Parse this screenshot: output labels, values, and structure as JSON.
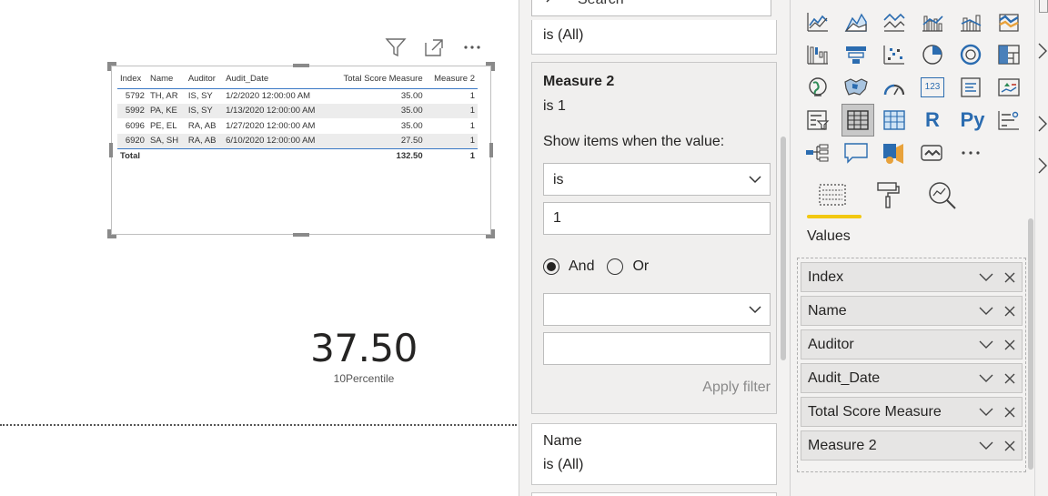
{
  "table": {
    "headers": [
      "Index",
      "Name",
      "Auditor",
      "Audit_Date",
      "Total Score Measure",
      "Measure 2"
    ],
    "rows": [
      [
        "5792",
        "TH, AR",
        "IS, SY",
        "1/2/2020 12:00:00 AM",
        "35.00",
        "1"
      ],
      [
        "5992",
        "PA, KE",
        "IS, SY",
        "1/13/2020 12:00:00 AM",
        "35.00",
        "1"
      ],
      [
        "6096",
        "PE, EL",
        "RA, AB",
        "1/27/2020 12:00:00 AM",
        "35.00",
        "1"
      ],
      [
        "6920",
        "SA, SH",
        "RA, AB",
        "6/10/2020 12:00:00 AM",
        "27.50",
        "1"
      ]
    ],
    "total": {
      "label": "Total",
      "score": "132.50",
      "measure2": "1"
    }
  },
  "card": {
    "value": "37.50",
    "label": "10Percentile"
  },
  "filters": {
    "search_label": "Search",
    "top_card_value": "is (All)",
    "measure_card": {
      "title": "Measure 2",
      "subtitle": "is 1",
      "show_items": "Show items when the value:",
      "condition1": "is",
      "value1": "1",
      "and_label": "And",
      "or_label": "Or",
      "condition2": "",
      "value2": "",
      "apply_label": "Apply filter"
    },
    "name_card": {
      "title": "Name",
      "value": "is (All)"
    }
  },
  "viz": {
    "values_label": "Values",
    "fields": [
      "Index",
      "Name",
      "Auditor",
      "Audit_Date",
      "Total Score Measure",
      "Measure 2"
    ],
    "icons_row1": [
      "line-chart-icon",
      "area-chart-icon",
      "stacked-area-chart-icon",
      "line-clustered-column-icon",
      "line-stacked-column-icon",
      "ribbon-chart-icon"
    ],
    "icons_row2": [
      "waterfall-chart-icon",
      "funnel-chart-icon",
      "scatter-chart-icon",
      "pie-chart-icon",
      "donut-chart-icon",
      "treemap-icon"
    ],
    "icons_row3": [
      "map-icon",
      "filled-map-icon",
      "gauge-icon",
      "card-icon",
      "multi-row-card-icon",
      "kpi-icon"
    ],
    "icons_row4": [
      "slicer-icon",
      "table-icon",
      "matrix-icon",
      "r-visual-icon",
      "python-visual-icon",
      "key-influencers-icon"
    ],
    "icons_row5": [
      "decomposition-tree-icon",
      "qa-icon",
      "smart-narrative-icon",
      "paginated-report-icon",
      "more-visuals-icon"
    ],
    "r_label": "R",
    "py_label": "Py",
    "card_icon_label": "123",
    "accent": "#f2c811"
  }
}
